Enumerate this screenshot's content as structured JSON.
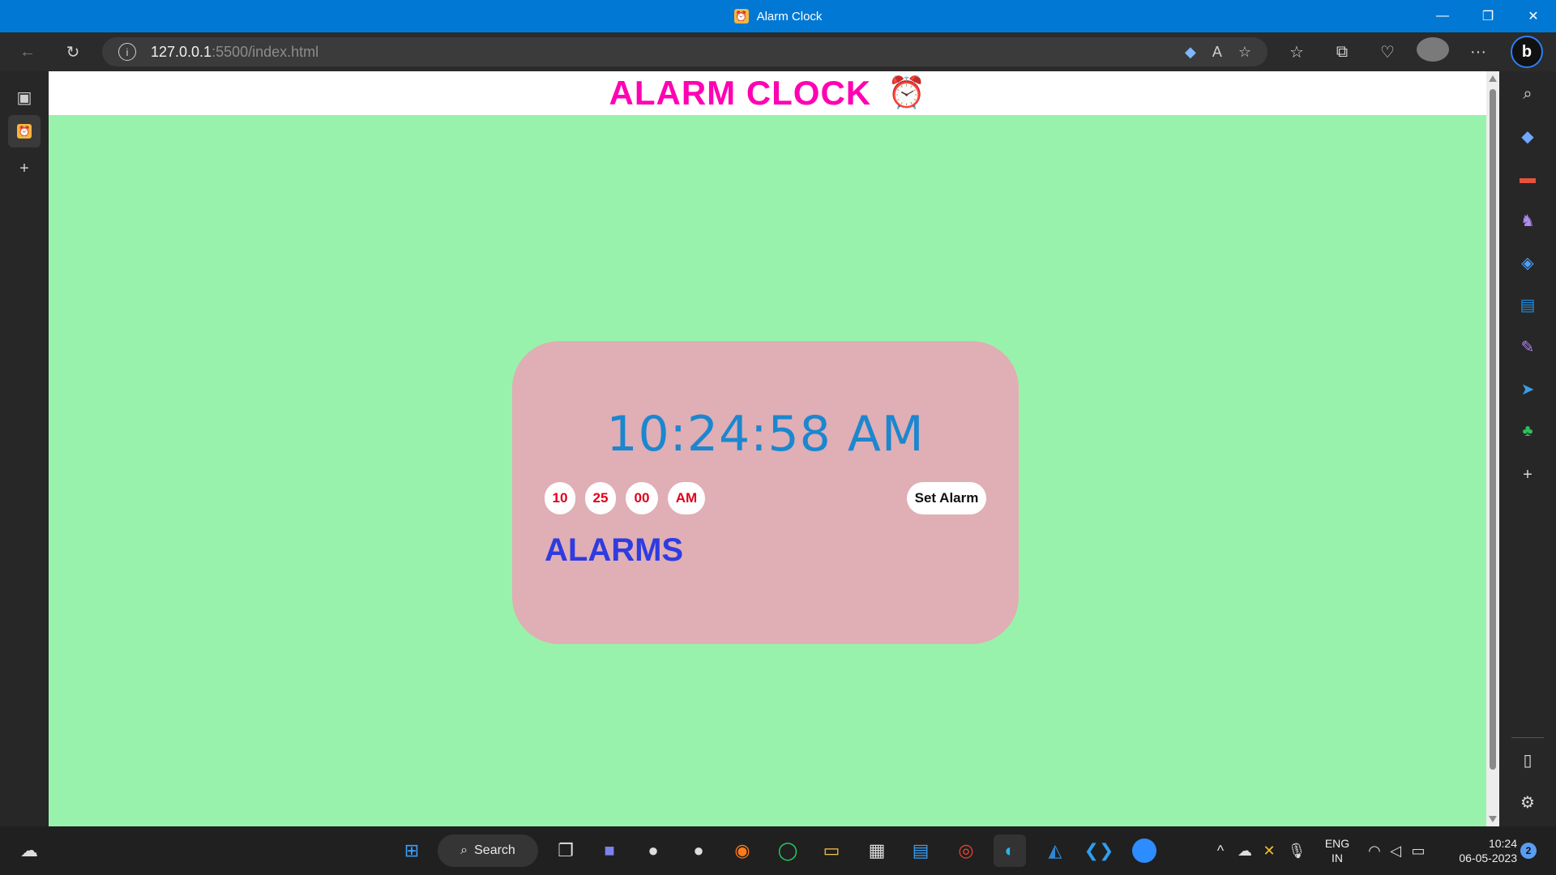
{
  "window": {
    "title": "Alarm Clock",
    "controls": {
      "minimize": "—",
      "restore": "❐",
      "close": "✕"
    }
  },
  "toolbar": {
    "url_host": "127.0.0.1",
    "url_rest": ":5500/index.html",
    "icons": [
      "back-icon",
      "reload-icon",
      "info-icon",
      "tag-icon",
      "read-aloud-icon",
      "add-favorite-icon",
      "favorites-icon",
      "collections-icon",
      "health-icon",
      "profile-avatar",
      "more-icon",
      "bing-icon"
    ]
  },
  "page": {
    "header_title": "ALARM CLOCK",
    "header_icon": "⏰",
    "current_time": "10:24:58 AM",
    "alarm_inputs": {
      "hour": "10",
      "minute": "25",
      "second": "00",
      "ampm": "AM"
    },
    "set_alarm_label": "Set Alarm",
    "alarms_heading": "ALARMS"
  },
  "taskbar": {
    "search_label": "Search",
    "lang_top": "ENG",
    "lang_bottom": "IN",
    "time": "10:24",
    "date": "06-05-2023",
    "notification_count": "2"
  },
  "colors": {
    "page_bg": "#99f2ab",
    "title": "#ff00b3",
    "card": "#e0aeb5",
    "time": "#1b87cf",
    "pill_text": "#e0001b",
    "alarms_heading": "#2e3ce0"
  }
}
